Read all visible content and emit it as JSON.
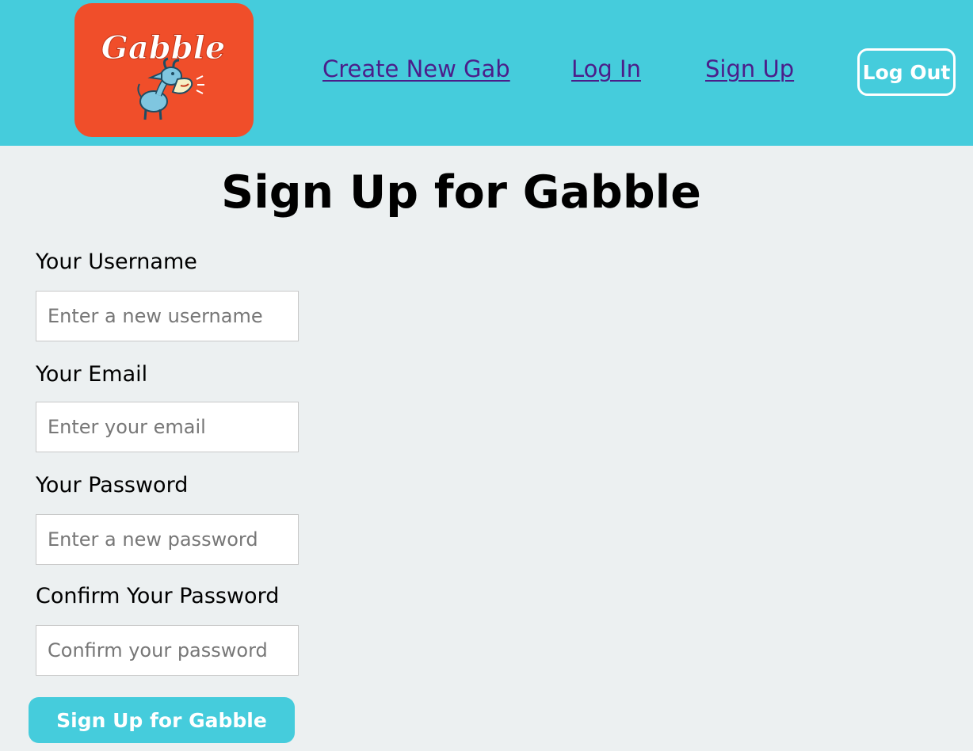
{
  "brand": {
    "logo_text": "Gabble",
    "logo_background": "#f04e2a",
    "icon": "goat-mascot-icon"
  },
  "colors": {
    "header_background": "#45ccdc",
    "page_background": "#ecf0f1",
    "link": "#4b1e8a",
    "button": "#45ccdc",
    "button_text": "#ffffff"
  },
  "nav": {
    "create_new_gab": "Create New Gab",
    "log_in": "Log In",
    "sign_up": "Sign Up",
    "log_out": "Log Out"
  },
  "form": {
    "title": "Sign Up for Gabble",
    "username": {
      "label": "Your Username",
      "placeholder": "Enter a new username",
      "value": ""
    },
    "email": {
      "label": "Your Email",
      "placeholder": "Enter your email",
      "value": ""
    },
    "password": {
      "label": "Your Password",
      "placeholder": "Enter a new password",
      "value": ""
    },
    "confirm_password": {
      "label": "Confirm Your Password",
      "placeholder": "Confirm your password",
      "value": ""
    },
    "submit_label": "Sign Up for Gabble"
  }
}
